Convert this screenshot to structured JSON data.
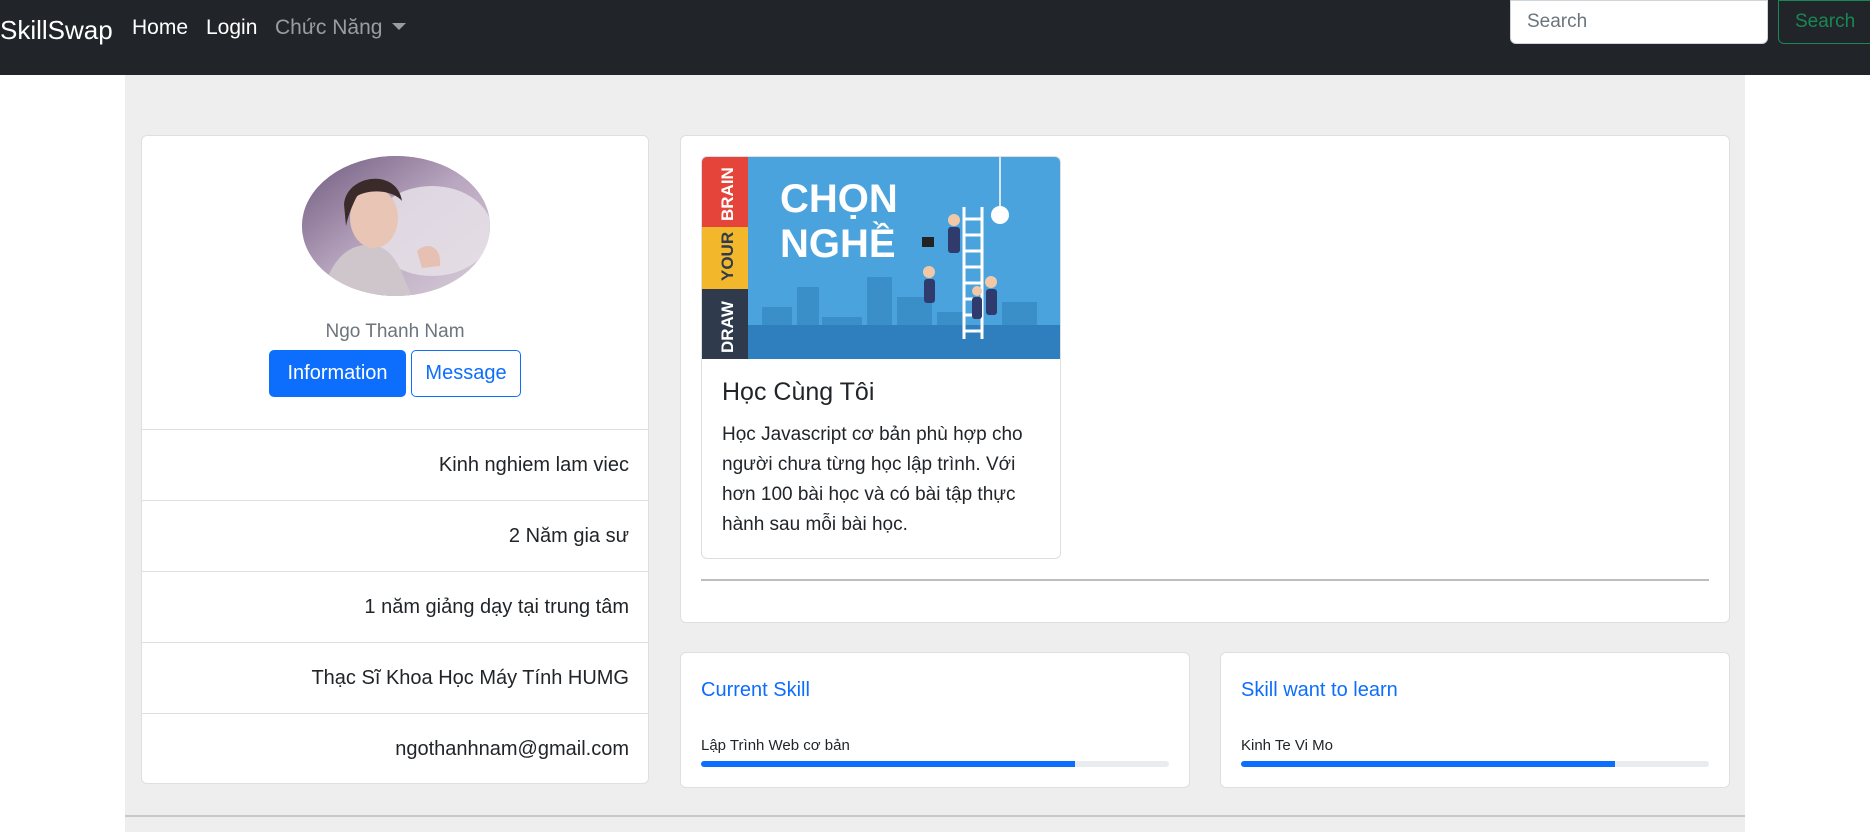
{
  "navbar": {
    "brand": "SkillSwap",
    "links": [
      {
        "label": "Home"
      },
      {
        "label": "Login"
      },
      {
        "label": "Chức Năng"
      }
    ],
    "search": {
      "placeholder": "Search",
      "value": "",
      "button_label": "Search"
    }
  },
  "profile": {
    "name": "Ngo Thanh Nam",
    "info_button": "Information",
    "message_button": "Message",
    "details": [
      "Kinh nghiem lam viec",
      "2 Năm gia sư",
      "1 năm giảng dạy tại trung tâm",
      "Thạc Sĩ Khoa Học Máy Tính HUMG",
      "ngothanhnam@gmail.com"
    ]
  },
  "course": {
    "image": {
      "headline_line1": "CHỌN",
      "headline_line2": "NGHỀ",
      "side_words": [
        "BRAIN",
        "YOUR",
        "DRAW"
      ]
    },
    "title": "Học Cùng Tôi",
    "description": "Học Javascript cơ bản phù hợp cho người chưa từng học lập trình. Với hơn 100 bài học và có bài tập thực hành sau mỗi bài học."
  },
  "skills": {
    "current": {
      "title": "Current Skill",
      "skill": "Lập Trình Web cơ bản",
      "progress_percent": 80
    },
    "learn": {
      "title": "Skill want to learn",
      "skill": "Kinh Te Vi Mo",
      "progress_percent": 80
    }
  },
  "colors": {
    "navbar_bg": "#212529",
    "primary": "#0d6efd",
    "success": "#198754",
    "container_bg": "#eeeeee",
    "banner_blue": "#4aa3dc"
  }
}
